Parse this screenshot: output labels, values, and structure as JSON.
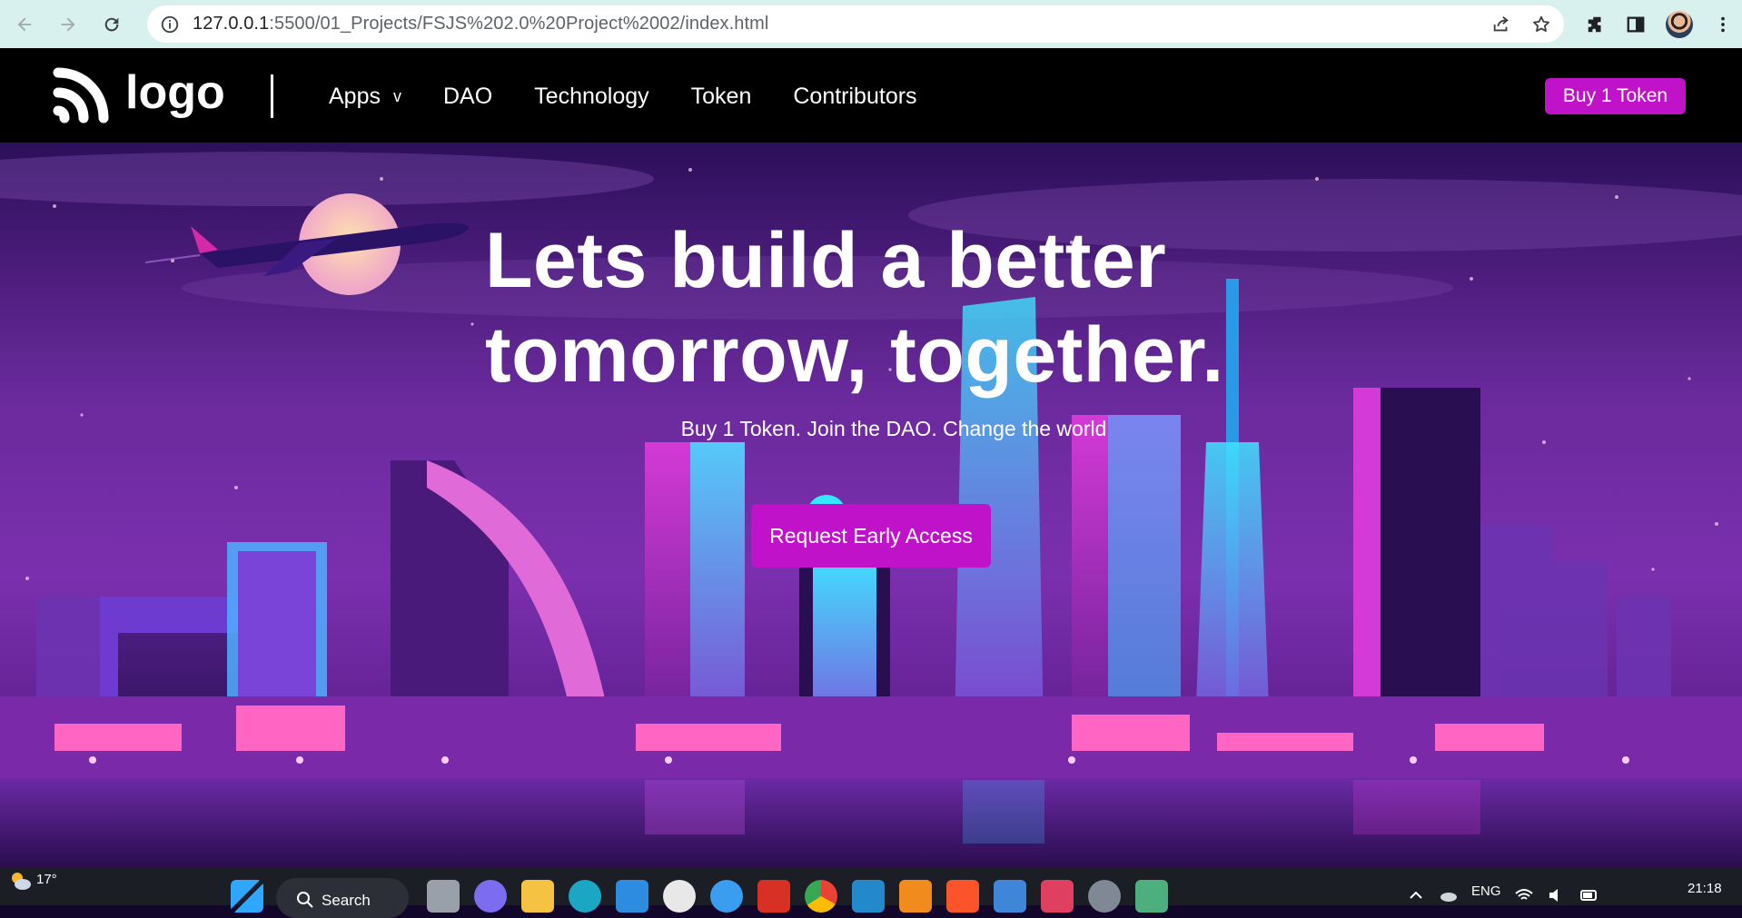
{
  "browser": {
    "url_host": "127.0.0.1",
    "url_path": ":5500/01_Projects/FSJS%202.0%20Project%2002/index.html",
    "icons": {
      "back": "back-arrow-icon",
      "forward": "forward-arrow-icon",
      "reload": "reload-icon",
      "info": "info-icon",
      "share": "share-icon",
      "bookmark": "star-icon",
      "extensions": "puzzle-icon",
      "side_panel": "side-panel-icon",
      "menu": "kebab-menu-icon"
    }
  },
  "header": {
    "logo_text": "logo",
    "nav": {
      "apps": "Apps",
      "apps_chevron": "v",
      "dao": "DAO",
      "technology": "Technology",
      "token": "Token",
      "contributors": "Contributors"
    },
    "cta": "Buy 1 Token"
  },
  "hero": {
    "title_line1": "Lets build a better",
    "title_line2": "tomorrow, together.",
    "subtitle": "Buy 1 Token. Join the DAO. Change the world",
    "button": "Request Early Access"
  },
  "taskbar": {
    "temperature": "17°",
    "search_label": "Search",
    "language": "ENG",
    "time": "21:18"
  },
  "colors": {
    "accent": "#c013c9",
    "header_bg": "#000000",
    "chrome_bg": "#d8f0ee",
    "taskbar_bg": "#1c1e26"
  }
}
